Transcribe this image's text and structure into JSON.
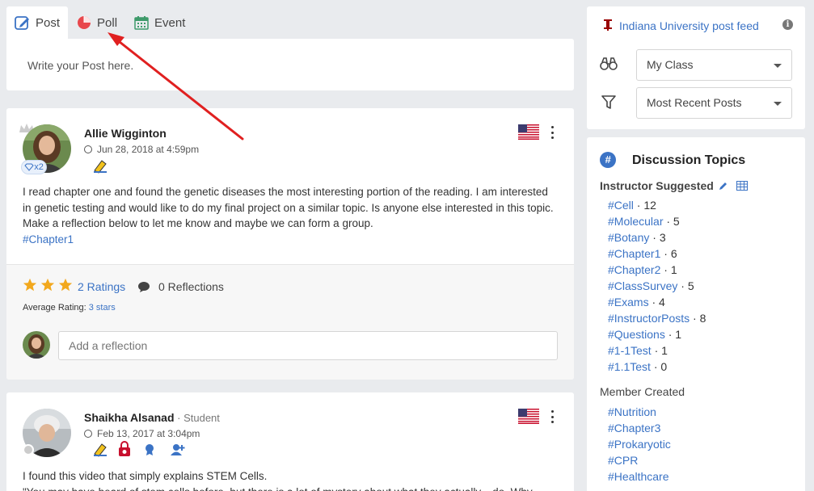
{
  "composer": {
    "tabs": [
      {
        "label": "Post",
        "icon": "post-edit-icon",
        "active": true
      },
      {
        "label": "Poll",
        "icon": "pie-chart-icon",
        "active": false
      },
      {
        "label": "Event",
        "icon": "calendar-icon",
        "active": false
      }
    ],
    "placeholder": "Write your Post here."
  },
  "posts": [
    {
      "author": "Allie Wigginton",
      "role": "",
      "date": "Jun 28, 2018 at 4:59pm",
      "badge_count": "x2",
      "text": "I read chapter one and found the genetic diseases the most interesting portion of the reading. I am interested in genetic testing and would like to do my final project on a similar topic. Is anyone else interested in this topic. Make a reflection below to let me know and maybe we can form a group.",
      "hashtag": "#Chapter1",
      "ratings_label": "2 Ratings",
      "reflections_label": "0 Reflections",
      "avg_label": "Average Rating:",
      "avg_value": "3 stars",
      "stars": 3,
      "reflection_placeholder": "Add a reflection"
    },
    {
      "author": "Shaikha Alsanad",
      "role": " · Student",
      "date": "Feb 13, 2017 at 3:04pm",
      "text_line1": "I found this video that simply explains STEM Cells.",
      "text_line2": "\"You may have heard of stem cells before, but there is a lot of mystery about what they actually... do. Why"
    }
  ],
  "sidebar": {
    "feed_title": "Indiana University post feed",
    "class_select": "My Class",
    "sort_select": "Most Recent Posts",
    "discussion_title": "Discussion Topics",
    "instructor_title": "Instructor Suggested",
    "instructor_topics": [
      {
        "tag": "#Cell",
        "count": " · 12"
      },
      {
        "tag": "#Molecular",
        "count": " · 5"
      },
      {
        "tag": "#Botany",
        "count": " · 3"
      },
      {
        "tag": "#Chapter1",
        "count": " · 6"
      },
      {
        "tag": "#Chapter2",
        "count": " · 1"
      },
      {
        "tag": "#ClassSurvey",
        "count": " · 5"
      },
      {
        "tag": "#Exams",
        "count": " · 4"
      },
      {
        "tag": "#InstructorPosts",
        "count": " · 8"
      },
      {
        "tag": "#Questions",
        "count": " · 1"
      },
      {
        "tag": "#1-1Test",
        "count": " · 1"
      },
      {
        "tag": "#1.1Test",
        "count": " · 0"
      }
    ],
    "member_title": "Member Created",
    "member_topics": [
      {
        "tag": "#Nutrition"
      },
      {
        "tag": "#Chapter3"
      },
      {
        "tag": "#Prokaryotic"
      },
      {
        "tag": "#CPR"
      },
      {
        "tag": "#Healthcare"
      }
    ]
  },
  "colors": {
    "accent": "#3b73c5",
    "star": "#f2a81d",
    "annotation_arrow": "#e02020",
    "iu_crimson": "#990000"
  }
}
